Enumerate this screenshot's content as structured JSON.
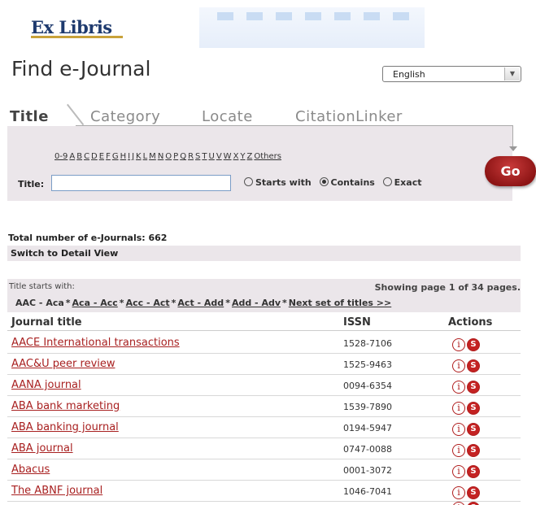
{
  "brand": {
    "logo_text": "Ex Libris"
  },
  "page": {
    "title": "Find e-Journal"
  },
  "language": {
    "selected": "English",
    "arrow_icon": "chevron-down-icon"
  },
  "tabs": [
    {
      "label": "Title",
      "active": true
    },
    {
      "label": "Category",
      "active": false
    },
    {
      "label": "Locate",
      "active": false
    },
    {
      "label": "CitationLinker",
      "active": false
    }
  ],
  "search": {
    "alphabet": [
      "0-9",
      "A",
      "B",
      "C",
      "D",
      "E",
      "F",
      "G",
      "H",
      "I",
      "J",
      "K",
      "L",
      "M",
      "N",
      "O",
      "P",
      "Q",
      "R",
      "S",
      "T",
      "U",
      "V",
      "W",
      "X",
      "Y",
      "Z",
      "Others"
    ],
    "title_label": "Title:",
    "title_value": "",
    "options": [
      {
        "label": "Starts with",
        "checked": false
      },
      {
        "label": "Contains",
        "checked": true
      },
      {
        "label": "Exact",
        "checked": false
      }
    ],
    "go_label": "Go"
  },
  "summary": {
    "total": "Total number of e-Journals: 662",
    "switch_view": "Switch to Detail View"
  },
  "results": {
    "starts_with_label": "Title starts with:",
    "paging": "Showing page 1 of 34 pages.",
    "current_range": "AAC - Aca",
    "ranges": [
      "Aca - Acc",
      "Acc - Act",
      "Act - Add",
      "Add - Adv"
    ],
    "next_set": "Next set of titles >>",
    "columns": {
      "title": "Journal title",
      "issn": "ISSN",
      "actions": "Actions"
    },
    "rows": [
      {
        "title": "AACE International transactions",
        "issn": "1528-7106"
      },
      {
        "title": "AAC&U peer review",
        "issn": "1525-9463"
      },
      {
        "title": "AANA journal",
        "issn": "0094-6354"
      },
      {
        "title": "ABA bank marketing",
        "issn": "1539-7890"
      },
      {
        "title": "ABA banking journal",
        "issn": "0194-5947"
      },
      {
        "title": "ABA journal",
        "issn": "0747-0088"
      },
      {
        "title": "Abacus",
        "issn": "0001-3072"
      },
      {
        "title": "The ABNF journal",
        "issn": "1046-7041"
      }
    ],
    "action_icons": {
      "info": "i",
      "sfx": "S"
    }
  },
  "colors": {
    "accent_red": "#a82020",
    "panel_bg": "#ebe6ea",
    "go_button": "#8c1414",
    "logo_blue": "#1e3a6e"
  }
}
